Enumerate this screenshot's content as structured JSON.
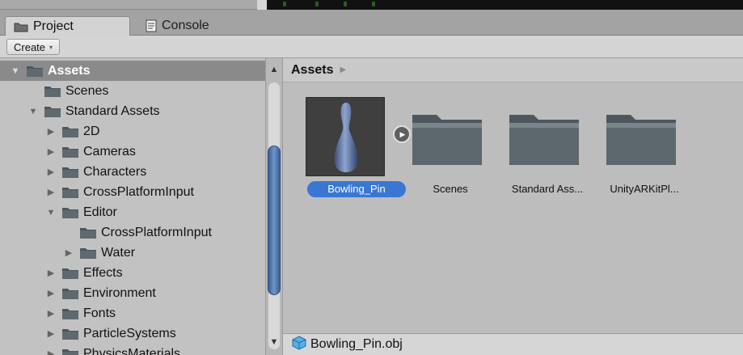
{
  "tabs": [
    {
      "label": "Project",
      "icon": "folder-icon",
      "active": true
    },
    {
      "label": "Console",
      "icon": "console-icon",
      "active": false
    }
  ],
  "toolbar": {
    "create_label": "Create",
    "create_caret": "▾"
  },
  "tree": {
    "rows": [
      {
        "label": "Assets",
        "depth": 0,
        "expander": "▼",
        "selected": true
      },
      {
        "label": "Scenes",
        "depth": 1,
        "expander": "",
        "selected": false
      },
      {
        "label": "Standard Assets",
        "depth": 1,
        "expander": "▼",
        "selected": false
      },
      {
        "label": "2D",
        "depth": 2,
        "expander": "▶",
        "selected": false
      },
      {
        "label": "Cameras",
        "depth": 2,
        "expander": "▶",
        "selected": false
      },
      {
        "label": "Characters",
        "depth": 2,
        "expander": "▶",
        "selected": false
      },
      {
        "label": "CrossPlatformInput",
        "depth": 2,
        "expander": "▶",
        "selected": false
      },
      {
        "label": "Editor",
        "depth": 2,
        "expander": "▼",
        "selected": false
      },
      {
        "label": "CrossPlatformInput",
        "depth": 3,
        "expander": "",
        "selected": false
      },
      {
        "label": "Water",
        "depth": 3,
        "expander": "▶",
        "selected": false
      },
      {
        "label": "Effects",
        "depth": 2,
        "expander": "▶",
        "selected": false
      },
      {
        "label": "Environment",
        "depth": 2,
        "expander": "▶",
        "selected": false
      },
      {
        "label": "Fonts",
        "depth": 2,
        "expander": "▶",
        "selected": false
      },
      {
        "label": "ParticleSystems",
        "depth": 2,
        "expander": "▶",
        "selected": false
      },
      {
        "label": "PhysicsMaterials",
        "depth": 2,
        "expander": "▶",
        "selected": false
      }
    ]
  },
  "scrollbar": {
    "up": "▲",
    "down": "▼"
  },
  "content": {
    "breadcrumb": "Assets",
    "breadcrumb_sep": "▶",
    "assets": [
      {
        "label": "Bowling_Pin",
        "kind": "model",
        "selected": true
      },
      {
        "label": "Scenes",
        "kind": "folder",
        "selected": false
      },
      {
        "label": "Standard Ass...",
        "kind": "folder",
        "selected": false
      },
      {
        "label": "UnityARKitPl...",
        "kind": "folder",
        "selected": false
      }
    ],
    "expand_arrow": "▶"
  },
  "statusbar": {
    "path": "Bowling_Pin.obj",
    "icon": "mesh-icon"
  }
}
